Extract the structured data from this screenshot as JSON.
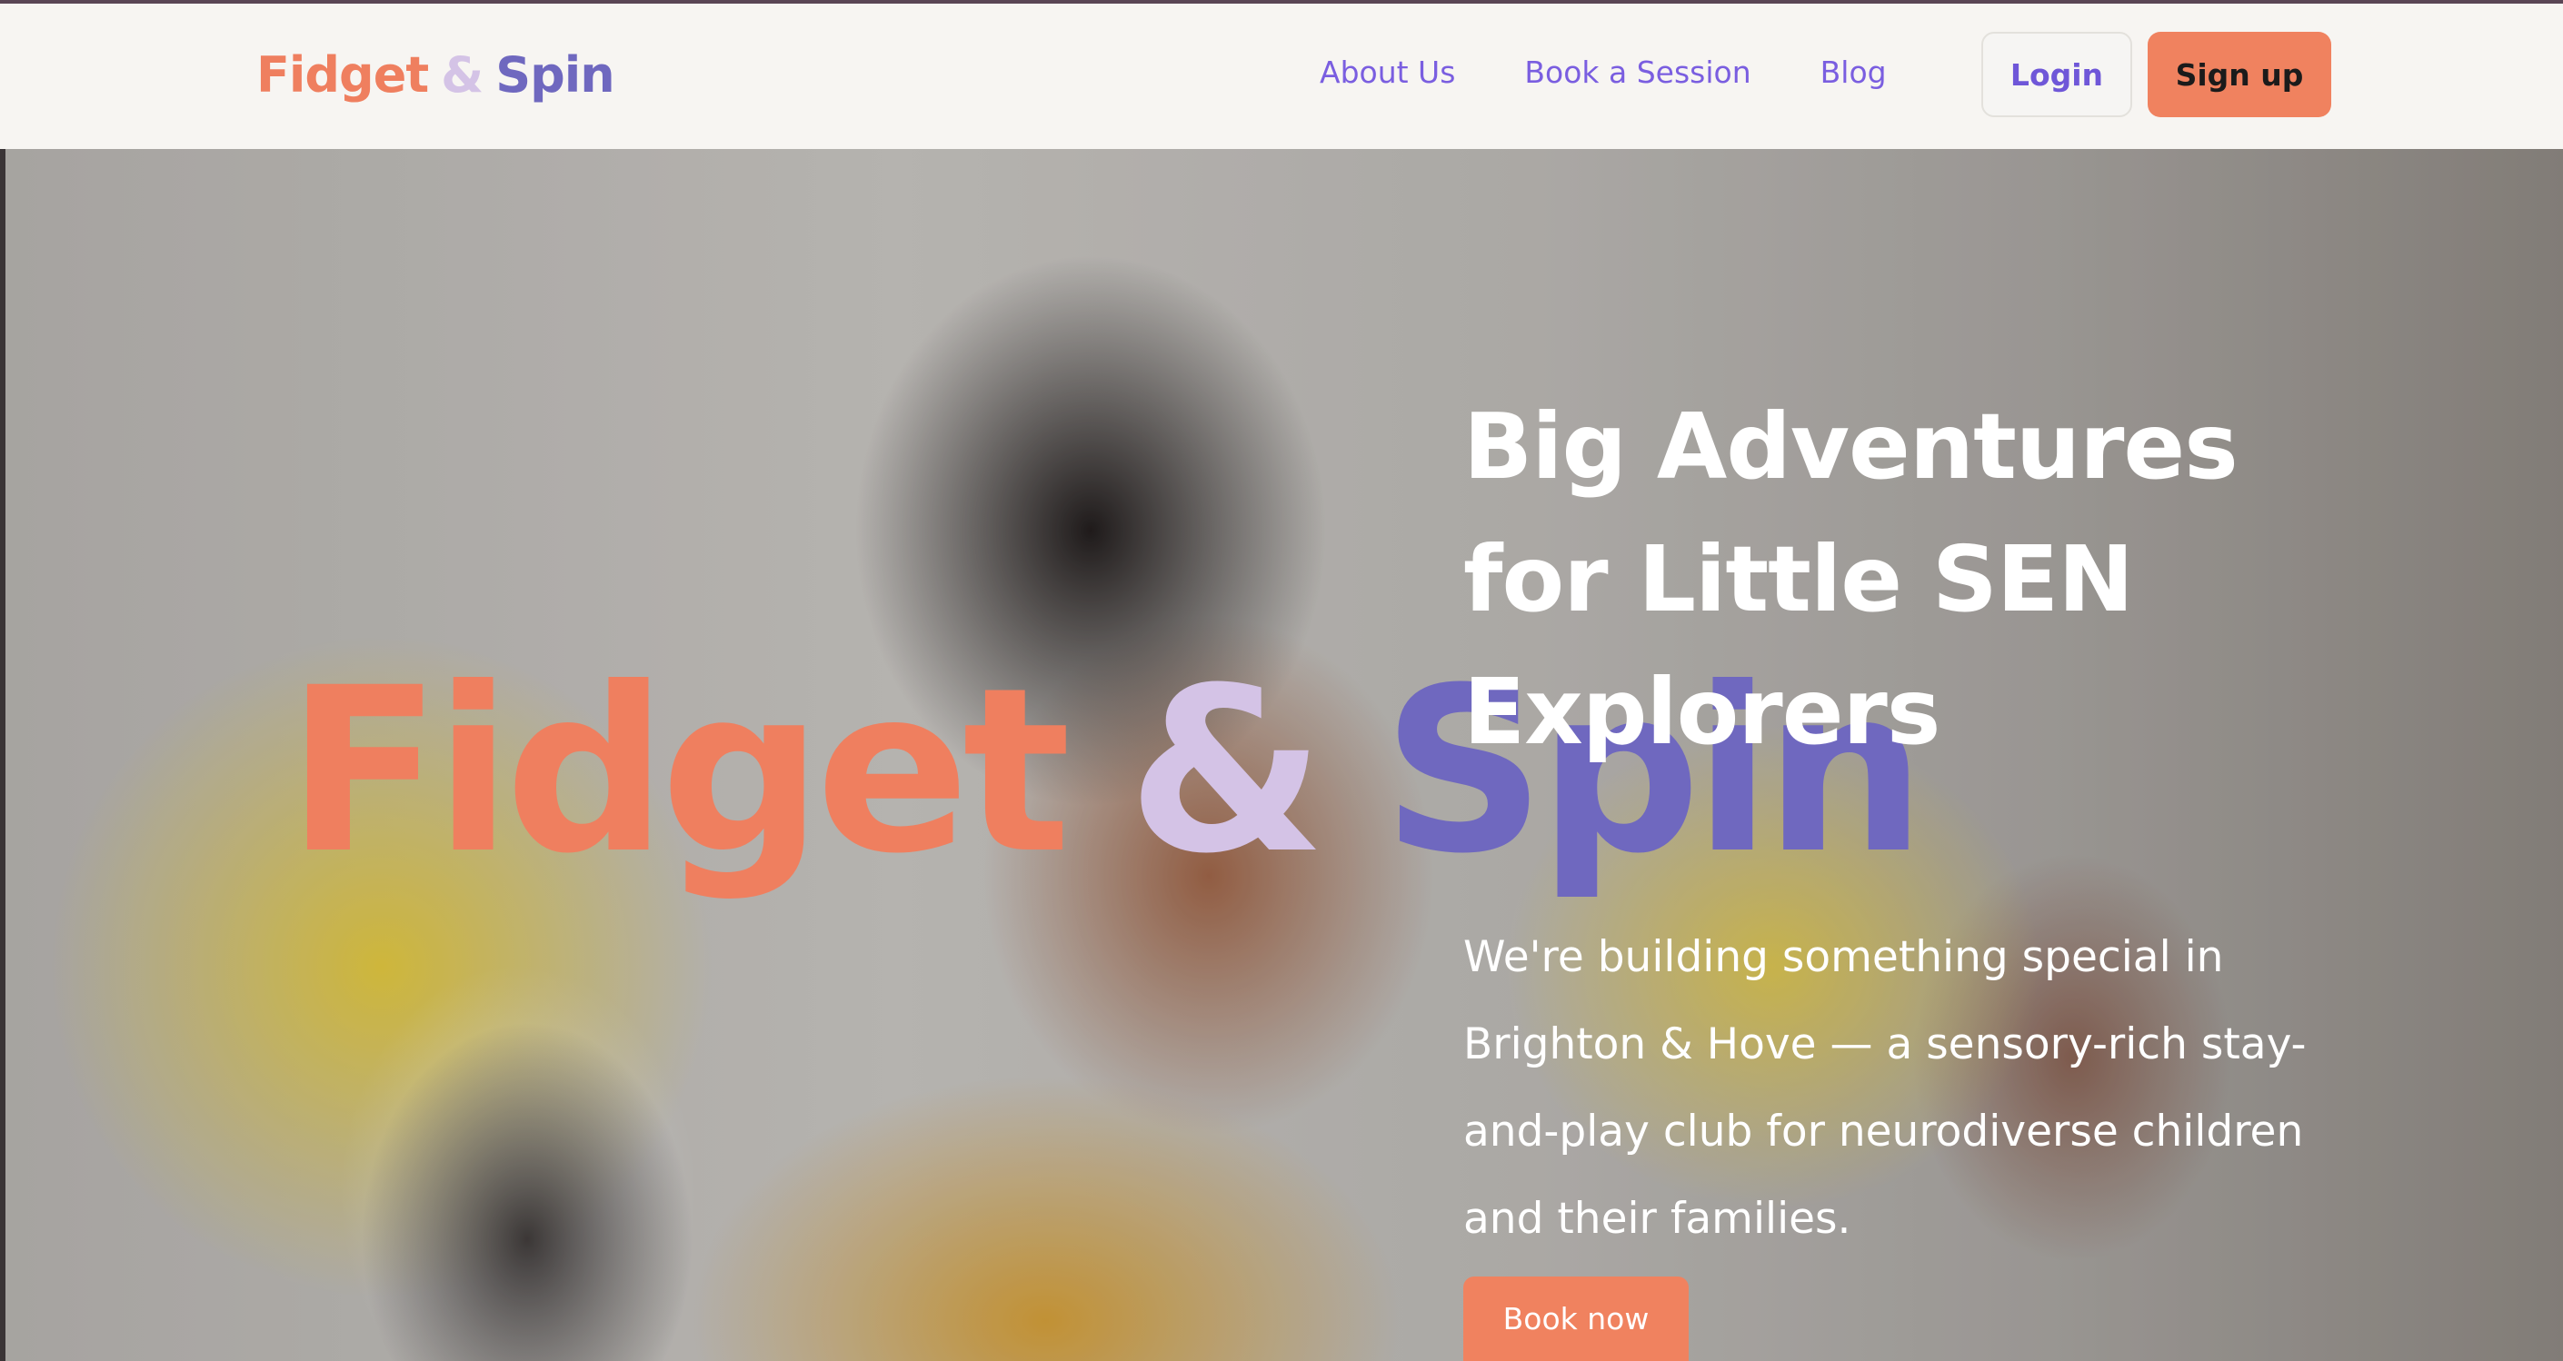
{
  "brand": {
    "part1": "Fidget",
    "amp": "&",
    "part2": "Spin",
    "colors": {
      "fidget": "#ef7f5f",
      "amp": "#d4c3e6",
      "spin": "#6f68bf"
    }
  },
  "nav": {
    "links": [
      "About Us",
      "Book a Session",
      "Blog"
    ],
    "login_label": "Login",
    "signup_label": "Sign up"
  },
  "hero": {
    "headline": "Big Adventures for Little SEN Explorers",
    "subtext": "We're building something special in Brighton & Hove — a sensory-rich stay-and-play club for neurodiverse children and their families.",
    "cta_label": "Book now"
  },
  "colors": {
    "nav_link": "#7a5ee0",
    "accent": "#f0825f",
    "navbar_bg": "#f7f5f2"
  }
}
